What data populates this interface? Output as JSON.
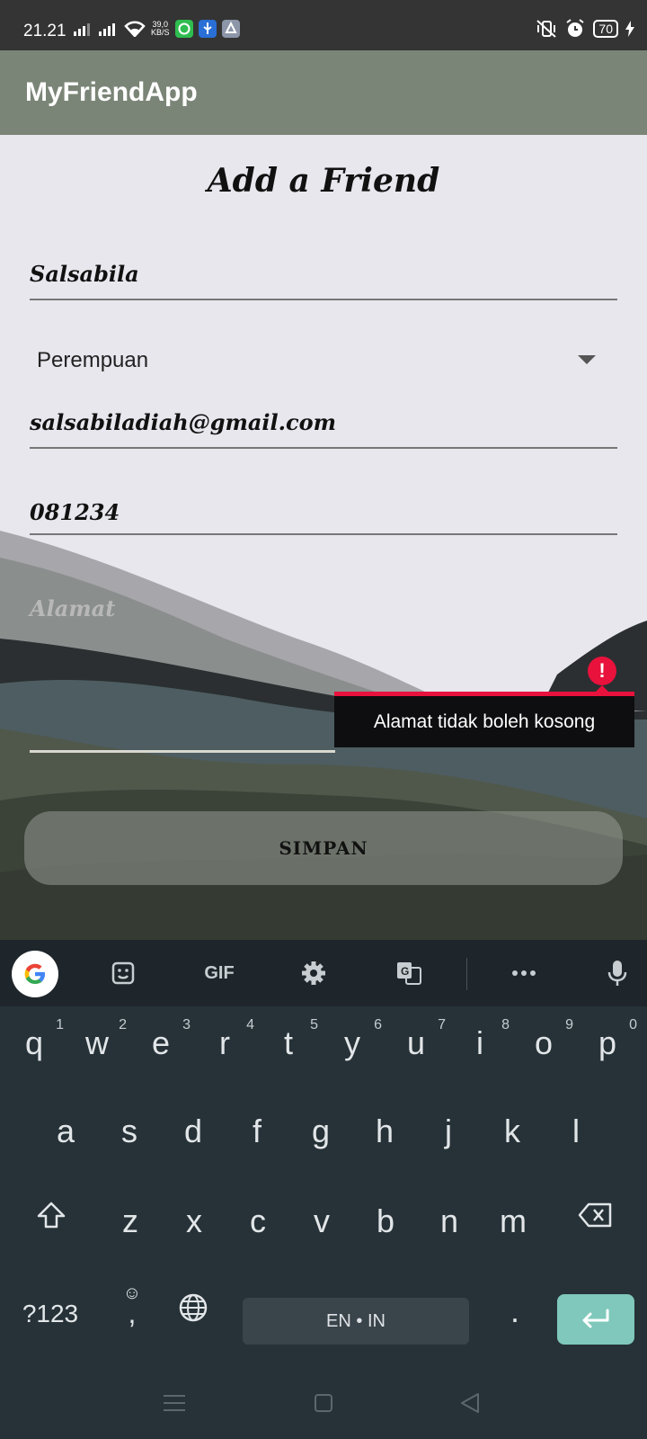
{
  "status_bar": {
    "time": "21.21",
    "net_speed": "39,0",
    "net_unit": "KB/S",
    "battery": "70"
  },
  "app": {
    "title": "MyFriendApp"
  },
  "form": {
    "title": "Add a Friend",
    "name_value": "Salsabila",
    "gender_value": "Perempuan",
    "email_value": "salsabiladiah@gmail.com",
    "phone_value": "081234",
    "address_placeholder": "Alamat",
    "address_error": "Alamat tidak boleh kosong",
    "save_label": "SIMPAN"
  },
  "keyboard": {
    "row1": [
      "q",
      "w",
      "e",
      "r",
      "t",
      "y",
      "u",
      "i",
      "o",
      "p"
    ],
    "row1_numbers": [
      "1",
      "2",
      "3",
      "4",
      "5",
      "6",
      "7",
      "8",
      "9",
      "0"
    ],
    "row2": [
      "a",
      "s",
      "d",
      "f",
      "g",
      "h",
      "j",
      "k",
      "l"
    ],
    "row3": [
      "z",
      "x",
      "c",
      "v",
      "b",
      "n",
      "m"
    ],
    "symbols_label": "?123",
    "comma": ",",
    "period": ".",
    "space_label": "EN • IN",
    "toolbar": {
      "gif_label": "GIF"
    }
  },
  "colors": {
    "app_bar": "#7b8577",
    "error": "#e8123c",
    "enter_key": "#7fc8bb"
  }
}
